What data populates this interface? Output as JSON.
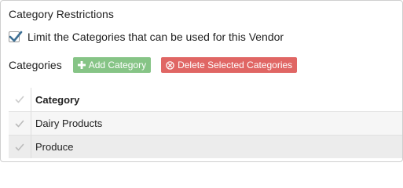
{
  "section": {
    "title": "Category Restrictions",
    "limit_checkbox": {
      "label": "Limit the Categories that can be used for this Vendor",
      "checked": true
    }
  },
  "categories": {
    "title": "Categories",
    "add_button": {
      "label": "Add Category",
      "icon": "plus-icon",
      "color": "#86c486"
    },
    "delete_button": {
      "label": "Delete Selected Categories",
      "icon": "circle-x-icon",
      "color": "#e06664"
    }
  },
  "table": {
    "header": "Category",
    "rows": [
      {
        "name": "Dairy Products"
      },
      {
        "name": "Produce"
      }
    ]
  },
  "colors": {
    "checkbox_tick": "#3d6f94",
    "row_check": "#cccccc"
  }
}
